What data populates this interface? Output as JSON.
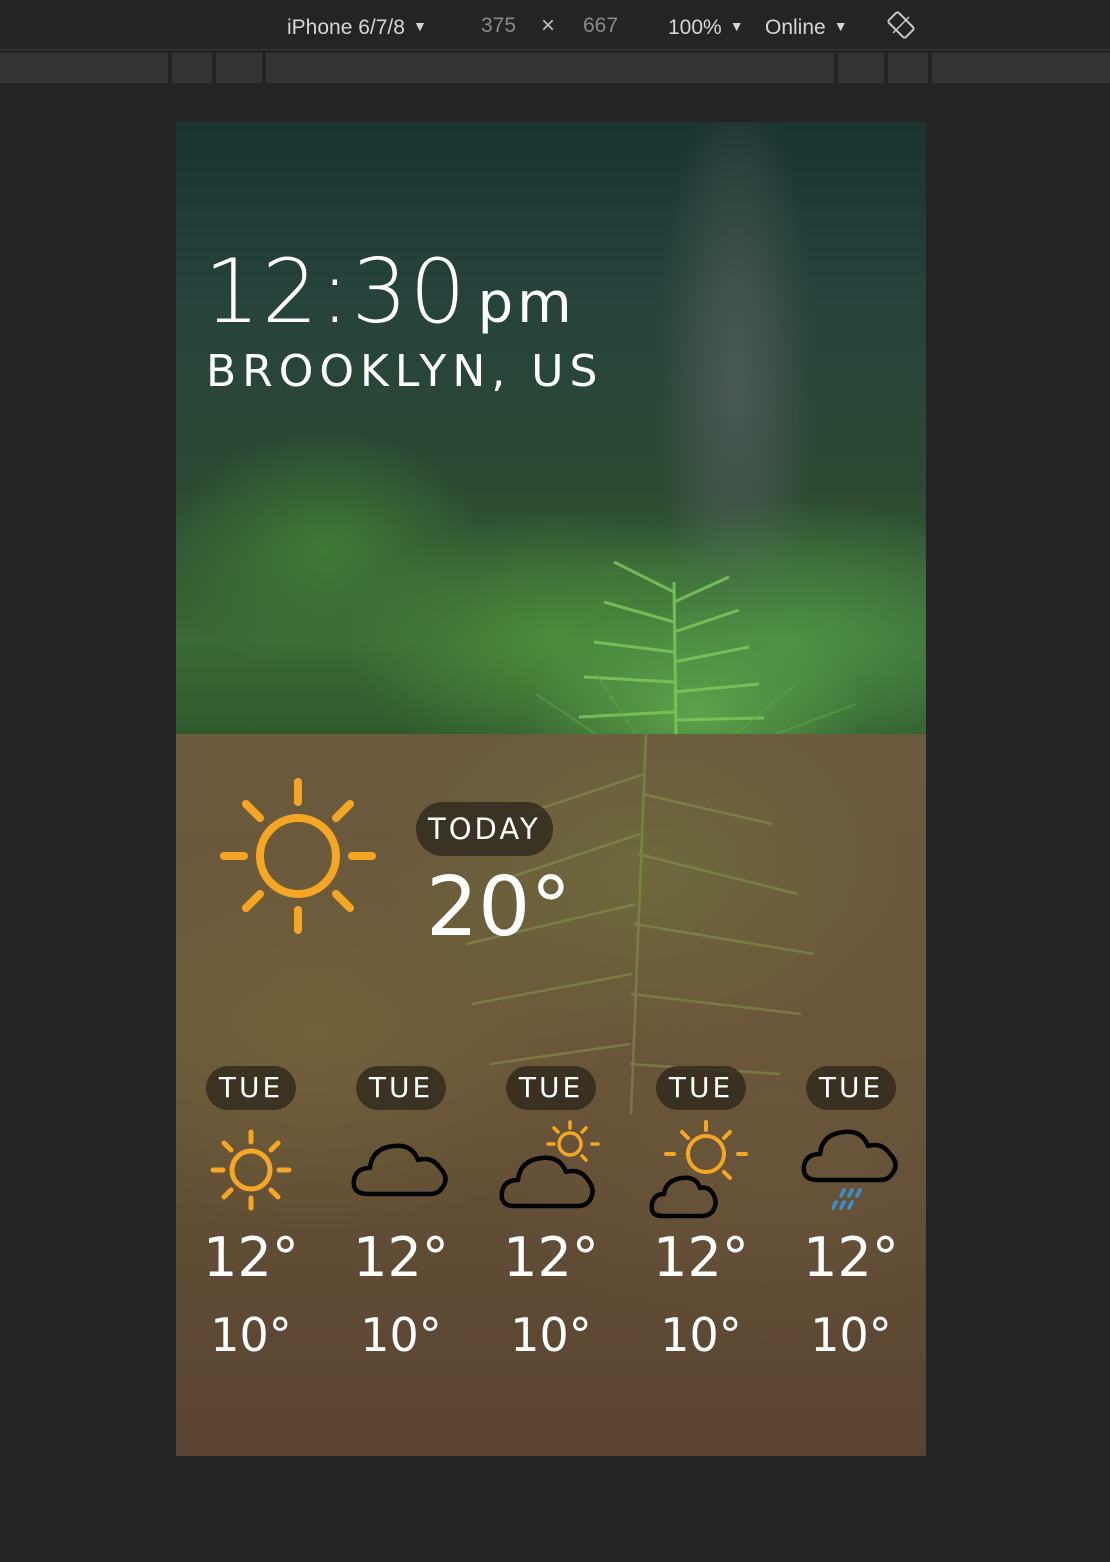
{
  "toolbar": {
    "device": "iPhone 6/7/8",
    "width": "375",
    "times": "×",
    "height": "667",
    "zoom": "100%",
    "network": "Online",
    "rotate_icon": "rotate-icon"
  },
  "weather": {
    "time": "12:30",
    "ampm": "pm",
    "location": "BROOKLYN, US",
    "today": {
      "label": "TODAY",
      "temp": "20°",
      "icon": "sun-icon"
    },
    "forecast": [
      {
        "day": "TUE",
        "high": "12°",
        "low": "10°",
        "icon": "sun-icon"
      },
      {
        "day": "TUE",
        "high": "12°",
        "low": "10°",
        "icon": "cloud-icon"
      },
      {
        "day": "TUE",
        "high": "12°",
        "low": "10°",
        "icon": "partly-cloudy-icon"
      },
      {
        "day": "TUE",
        "high": "12°",
        "low": "10°",
        "icon": "sun-behind-cloud-icon"
      },
      {
        "day": "TUE",
        "high": "12°",
        "low": "10°",
        "icon": "rain-cloud-icon"
      }
    ]
  },
  "colors": {
    "sun": "#f5a623",
    "rain": "#3a8fd6",
    "text": "#ffffff",
    "pill": "#2d261c"
  }
}
